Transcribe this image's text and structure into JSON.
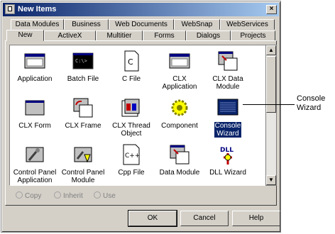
{
  "window": {
    "title": "New Items",
    "close_glyph": "×"
  },
  "tabs_back": [
    "Data Modules",
    "Business",
    "Web Documents",
    "WebSnap",
    "WebServices"
  ],
  "tabs_front": [
    "New",
    "ActiveX",
    "Multitier",
    "Forms",
    "Dialogs",
    "Projects"
  ],
  "active_tab": "New",
  "items": [
    {
      "label": "Application",
      "icon": "application-icon"
    },
    {
      "label": "Batch File",
      "icon": "batch-file-icon"
    },
    {
      "label": "C File",
      "icon": "c-file-icon"
    },
    {
      "label": "CLX\nApplication",
      "icon": "clx-application-icon"
    },
    {
      "label": "CLX Data\nModule",
      "icon": "clx-data-module-icon"
    },
    {
      "label": "CLX Form",
      "icon": "clx-form-icon"
    },
    {
      "label": "CLX Frame",
      "icon": "clx-frame-icon"
    },
    {
      "label": "CLX Thread\nObject",
      "icon": "clx-thread-object-icon"
    },
    {
      "label": "Component",
      "icon": "component-icon"
    },
    {
      "label": "Console\nWizard",
      "icon": "console-wizard-icon",
      "selected": true
    },
    {
      "label": "Control Panel\nApplication",
      "icon": "control-panel-application-icon"
    },
    {
      "label": "Control Panel\nModule",
      "icon": "control-panel-module-icon"
    },
    {
      "label": "Cpp File",
      "icon": "cpp-file-icon"
    },
    {
      "label": "Data Module",
      "icon": "data-module-icon"
    },
    {
      "label": "DLL Wizard",
      "icon": "dll-wizard-icon"
    }
  ],
  "options": [
    "Copy",
    "Inherit",
    "Use"
  ],
  "buttons": {
    "ok": "OK",
    "cancel": "Cancel",
    "help": "Help"
  },
  "callout": "Console\nWizard",
  "colors": {
    "titlebar_start": "#0a246a",
    "titlebar_end": "#a6caf0",
    "selection": "#0a246a",
    "face": "#d4d0c8"
  }
}
